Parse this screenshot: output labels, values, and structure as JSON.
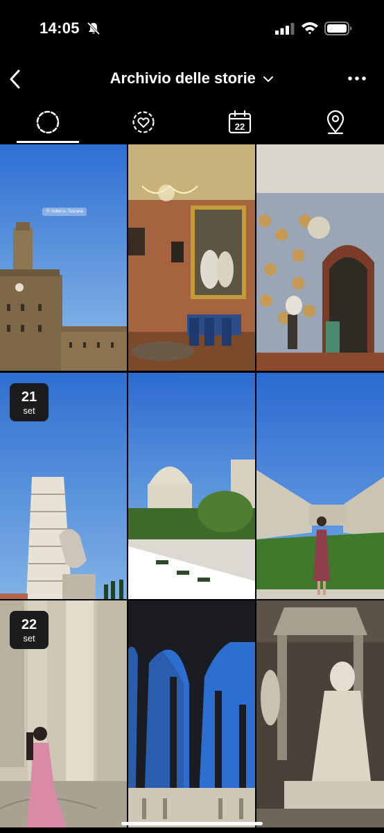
{
  "status_bar": {
    "time": "14:05",
    "icons": [
      "bell-slash-icon",
      "signal-icon",
      "wifi-icon",
      "battery-icon"
    ]
  },
  "header": {
    "title": "Archivio delle storie",
    "back_icon": "chevron-left-icon",
    "dropdown_icon": "chevron-down-icon",
    "more_icon": "more-horizontal-icon"
  },
  "tabs": [
    {
      "id": "stories",
      "icon": "story-ring-icon",
      "active": true
    },
    {
      "id": "highlights",
      "icon": "heart-ring-icon",
      "active": false
    },
    {
      "id": "calendar",
      "icon": "calendar-icon",
      "label": "22",
      "active": false
    },
    {
      "id": "map",
      "icon": "location-pin-icon",
      "active": false
    }
  ],
  "grid": {
    "tiles": [
      {
        "scene": "Volterra town hall tower under blue sky",
        "location_sticker": "Volterra, Toscana"
      },
      {
        "scene": "Ornate palace room with chandelier and portrait"
      },
      {
        "scene": "Palace hall with decorative plates and chandelier"
      },
      {
        "scene": "Leaning Tower of Pisa with statue",
        "date": {
          "day": "21",
          "month": "set"
        }
      },
      {
        "scene": "Baptistery with outdoor dining tables"
      },
      {
        "scene": "Camposanto courtyard with woman in pink dress"
      },
      {
        "scene": "Woman in pink dress by marble columns",
        "date": {
          "day": "22",
          "month": "set"
        }
      },
      {
        "scene": "Gothic arches of cloister against sky"
      },
      {
        "scene": "Marble seated statue in monument niche"
      }
    ]
  },
  "colors": {
    "background": "#000000",
    "sky": "#3f7fd6",
    "badge_bg": "#1c1c1e"
  }
}
